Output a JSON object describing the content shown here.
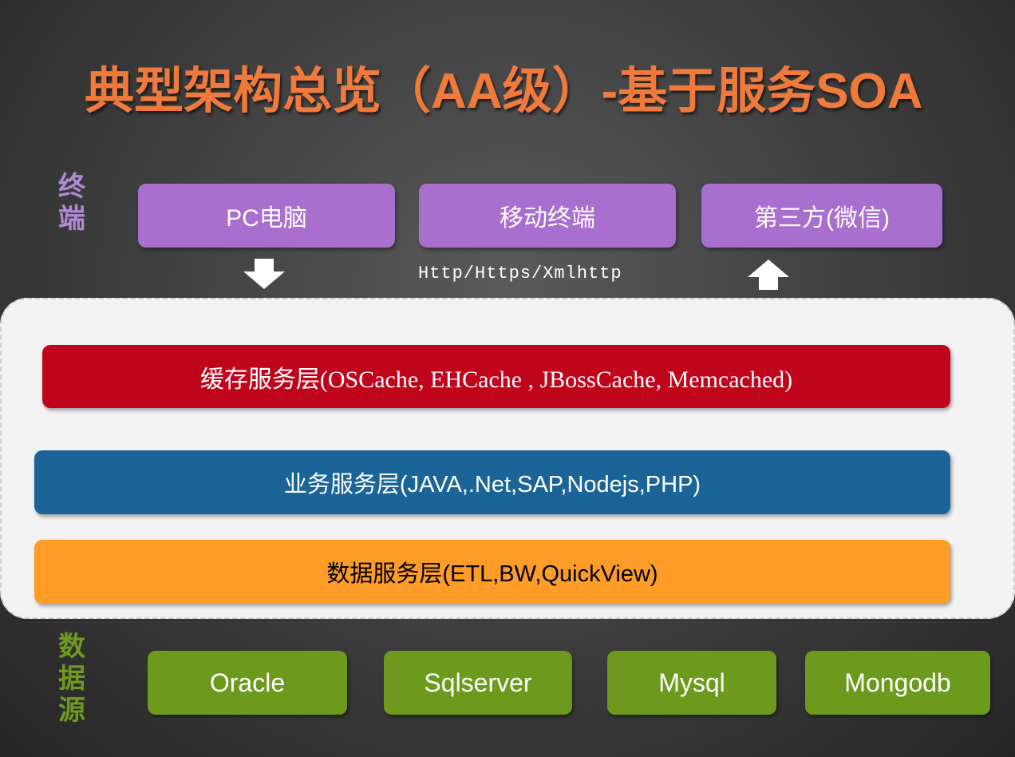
{
  "title": "典型架构总览（AA级）-基于服务SOA",
  "terminal_label": [
    "终",
    "端"
  ],
  "terminals": [
    "PC电脑",
    "移动终端",
    "第三方(微信)"
  ],
  "protocol": "Http/Https/Xmlhttp",
  "layers": {
    "cache": "缓存服务层(OSCache, EHCache , JBossCache, Memcached)",
    "business": "业务服务层(JAVA,.Net,SAP,Nodejs,PHP)",
    "data": "数据服务层(ETL,BW,QuickView)"
  },
  "source_label": [
    "数",
    "据",
    "源"
  ],
  "databases": [
    "Oracle",
    "Sqlserver",
    "Mysql",
    "Mongodb"
  ],
  "colors": {
    "title": "#f07a3c",
    "terminal": "#a86fcf",
    "cache_layer": "#c0041c",
    "business_layer": "#1a6498",
    "data_layer": "#fd9c27",
    "database": "#6d9a1c"
  }
}
